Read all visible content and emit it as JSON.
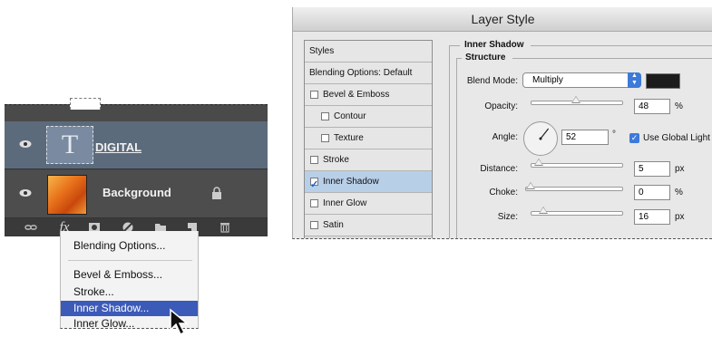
{
  "layers_panel": {
    "layers": [
      {
        "name": "DIGITAL",
        "type_glyph": "T",
        "visible": true,
        "selected": true
      },
      {
        "name": "Background",
        "visible": true,
        "locked": true
      }
    ],
    "footer_icons": [
      "link-icon",
      "fx-icon",
      "mask-icon",
      "adjustment-icon",
      "folder-icon",
      "new-layer-icon",
      "trash-icon"
    ],
    "fx_label": "fx"
  },
  "fx_menu": {
    "items": [
      {
        "label": "Blending Options..."
      },
      {
        "label": "Bevel & Emboss..."
      },
      {
        "label": "Stroke..."
      },
      {
        "label": "Inner Shadow...",
        "highlighted": true
      },
      {
        "label": "Inner Glow..."
      }
    ],
    "highlight_color": "#3c5ab8"
  },
  "dialog": {
    "title": "Layer Style",
    "styles_list": [
      {
        "label": "Styles",
        "checkbox": false
      },
      {
        "label": "Blending Options: Default",
        "checkbox": false
      },
      {
        "label": "Bevel & Emboss",
        "checkbox": true,
        "checked": false
      },
      {
        "label": "Contour",
        "checkbox": true,
        "checked": false,
        "indent": true
      },
      {
        "label": "Texture",
        "checkbox": true,
        "checked": false,
        "indent": true
      },
      {
        "label": "Stroke",
        "checkbox": true,
        "checked": false
      },
      {
        "label": "Inner Shadow",
        "checkbox": true,
        "checked": true,
        "selected": true
      },
      {
        "label": "Inner Glow",
        "checkbox": true,
        "checked": false
      },
      {
        "label": "Satin",
        "checkbox": true,
        "checked": false
      }
    ],
    "section_title": "Inner Shadow",
    "group_title": "Structure",
    "blend_mode": {
      "label": "Blend Mode:",
      "value": "Multiply",
      "swatch_color": "#1c1c1c"
    },
    "opacity": {
      "label": "Opacity:",
      "value": "48",
      "unit": "%",
      "fraction": 0.48
    },
    "angle": {
      "label": "Angle:",
      "value": "52",
      "unit": "°",
      "global_light_label": "Use Global Light",
      "global_light": true
    },
    "distance": {
      "label": "Distance:",
      "value": "5",
      "unit": "px",
      "fraction": 0.03
    },
    "choke": {
      "label": "Choke:",
      "value": "0",
      "unit": "%",
      "fraction": 0.0
    },
    "size": {
      "label": "Size:",
      "value": "16",
      "unit": "px",
      "fraction": 0.09
    }
  }
}
